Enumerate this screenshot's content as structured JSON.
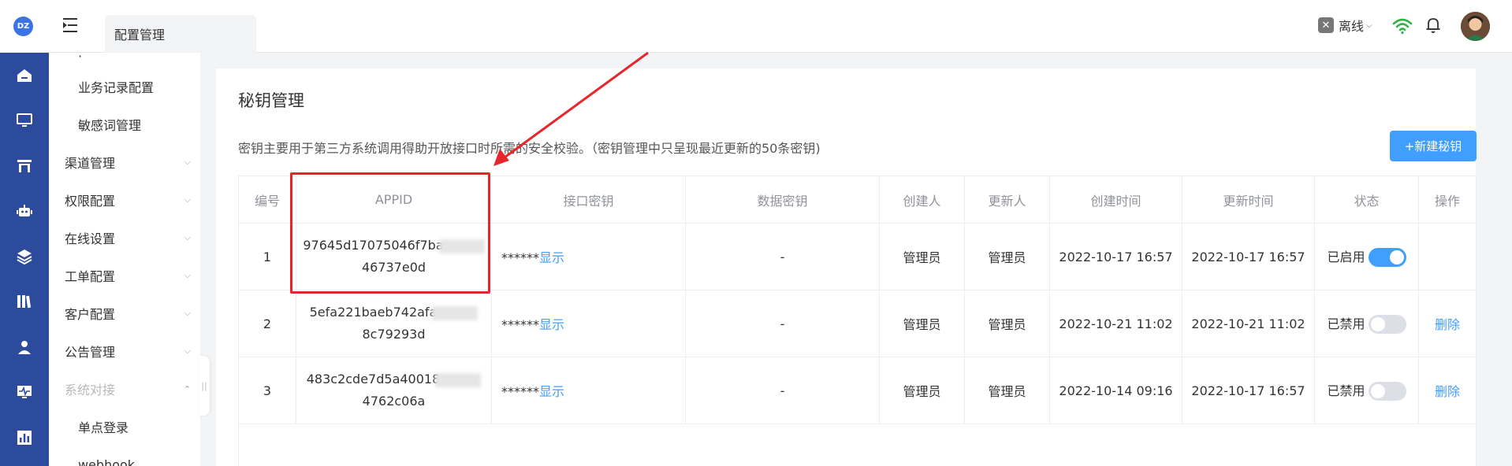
{
  "header": {
    "logo_text": "DZ",
    "tab_title": "配置管理",
    "status_label": "离线",
    "status_chevron": "⌵",
    "colors": {
      "accent": "#409eff",
      "rail": "#2d4b9c",
      "annotation": "#e5262b",
      "wifi": "#2fb344"
    }
  },
  "sidebar": {
    "items": [
      {
        "label": "业务记录配置",
        "type": "sub"
      },
      {
        "label": "敏感词管理",
        "type": "sub"
      },
      {
        "label": "渠道管理",
        "type": "top",
        "arrow": "⌵"
      },
      {
        "label": "权限配置",
        "type": "top",
        "arrow": "⌵"
      },
      {
        "label": "在线设置",
        "type": "top",
        "arrow": "⌵"
      },
      {
        "label": "工单配置",
        "type": "top",
        "arrow": "⌵"
      },
      {
        "label": "客户配置",
        "type": "top",
        "arrow": "⌵"
      },
      {
        "label": "公告管理",
        "type": "top",
        "arrow": "⌵"
      },
      {
        "label": "系统对接",
        "type": "top",
        "arrow": "⌃",
        "expanded": true
      },
      {
        "label": "单点登录",
        "type": "sub"
      },
      {
        "label": "webhook",
        "type": "sub"
      }
    ],
    "handle": "||"
  },
  "main": {
    "title": "秘钥管理",
    "description": "密钥主要用于第三方系统调用得助开放接口时所需的安全校验。（密钥管理中只呈现最近更新的50条密钥)",
    "new_button": "+新建秘钥",
    "columns": [
      "编号",
      "APPID",
      "接口密钥",
      "数据密钥",
      "创建人",
      "更新人",
      "创建时间",
      "更新时间",
      "状态",
      "操作"
    ],
    "rows": [
      {
        "no": "1",
        "appid_line1": "97645d17075046f7ba",
        "appid_line2": "46737e0d",
        "key_mask": "******",
        "key_link": "显示",
        "data_key": "-",
        "creator": "管理员",
        "updater": "管理员",
        "created": "2022-10-17 16:57",
        "updated": "2022-10-17 16:57",
        "status": "已启用",
        "enabled": true,
        "action": ""
      },
      {
        "no": "2",
        "appid_line1": "5efa221baeb742afa",
        "appid_line2": "8c79293d",
        "key_mask": "******",
        "key_link": "显示",
        "data_key": "-",
        "creator": "管理员",
        "updater": "管理员",
        "created": "2022-10-21 11:02",
        "updated": "2022-10-21 11:02",
        "status": "已禁用",
        "enabled": false,
        "action": "删除"
      },
      {
        "no": "3",
        "appid_line1": "483c2cde7d5a40018",
        "appid_line2": "4762c06a",
        "key_mask": "******",
        "key_link": "显示",
        "data_key": "-",
        "creator": "管理员",
        "updater": "管理员",
        "created": "2022-10-14 09:16",
        "updated": "2022-10-17 16:57",
        "status": "已禁用",
        "enabled": false,
        "action": "删除"
      }
    ]
  }
}
